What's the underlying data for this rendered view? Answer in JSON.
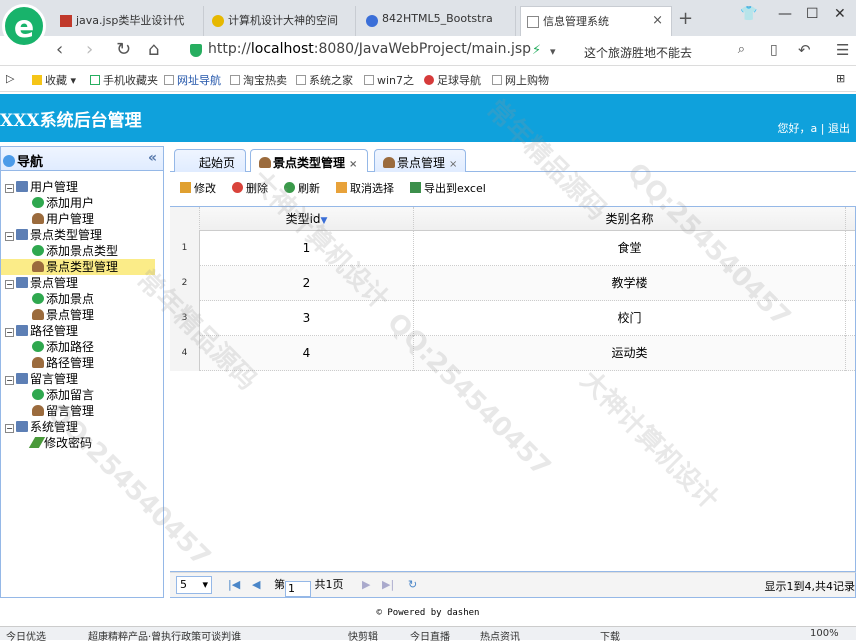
{
  "browser": {
    "tabs": [
      {
        "label": "java.jsp类毕业设计代",
        "fav_color": "#c0392b"
      },
      {
        "label": "计算机设计大神的空间",
        "fav_color": "#e6b800"
      },
      {
        "label": "842HTML5_Bootstra",
        "fav_color": "#3b6fd8"
      },
      {
        "label": "信息管理系统",
        "fav_color": "#888888"
      }
    ],
    "new_tab": "+",
    "url_prefix": "http://",
    "url_host": "localhost",
    "url_rest": ":8080/JavaWebProject/main.jsp",
    "search_text": "这个旅游胜地不能去",
    "bookmarks": [
      "收藏",
      "手机收藏夹",
      "网址导航",
      "淘宝热卖",
      "系统之家",
      "win7之",
      "足球导航",
      "网上购物"
    ]
  },
  "header": {
    "title": "XXX系统后台管理",
    "user": "您好，a",
    "logout": "退出"
  },
  "sidebar": {
    "title": "导航",
    "collapse": "«",
    "tree": [
      {
        "label": "用户管理",
        "children": [
          {
            "label": "添加用户",
            "icon": "add"
          },
          {
            "label": "用户管理",
            "icon": "user"
          }
        ]
      },
      {
        "label": "景点类型管理",
        "children": [
          {
            "label": "添加景点类型",
            "icon": "add"
          },
          {
            "label": "景点类型管理",
            "icon": "user",
            "selected": true
          }
        ]
      },
      {
        "label": "景点管理",
        "children": [
          {
            "label": "添加景点",
            "icon": "add"
          },
          {
            "label": "景点管理",
            "icon": "user"
          }
        ]
      },
      {
        "label": "路径管理",
        "children": [
          {
            "label": "添加路径",
            "icon": "add"
          },
          {
            "label": "路径管理",
            "icon": "user"
          }
        ]
      },
      {
        "label": "留言管理",
        "children": [
          {
            "label": "添加留言",
            "icon": "add"
          },
          {
            "label": "留言管理",
            "icon": "user"
          }
        ]
      },
      {
        "label": "系统管理",
        "children": [
          {
            "label": "修改密码",
            "icon": "pen"
          }
        ]
      }
    ]
  },
  "panel_tabs": [
    {
      "label": "起始页",
      "closable": false
    },
    {
      "label": "景点类型管理",
      "closable": true,
      "active": true
    },
    {
      "label": "景点管理",
      "closable": true
    }
  ],
  "toolbar": {
    "edit": "修改",
    "delete": "删除",
    "refresh": "刷新",
    "unselect": "取消选择",
    "export": "导出到excel"
  },
  "grid": {
    "columns": [
      "类型id",
      "类别名称"
    ],
    "sort_indicator": "▼",
    "rows": [
      {
        "n": "1",
        "id": "1",
        "name": "食堂"
      },
      {
        "n": "2",
        "id": "2",
        "name": "教学楼"
      },
      {
        "n": "3",
        "id": "3",
        "name": "校门"
      },
      {
        "n": "4",
        "id": "4",
        "name": "运动类"
      }
    ]
  },
  "pager": {
    "page_size": "5",
    "page_prefix": "第",
    "page_value": "1",
    "page_suffix": "共1页",
    "summary": "显示1到4,共4记录"
  },
  "footer": "© Powered by dashen",
  "status": {
    "left": "今日优选",
    "news": "超康精粹产品·曾执行政策可谈判谁",
    "items": [
      "快剪辑",
      "今日直播",
      "热点资讯",
      "下载",
      "100%"
    ]
  },
  "watermarks": [
    "QQ:254540457",
    "大神计算机设计",
    "常年精品源码"
  ]
}
